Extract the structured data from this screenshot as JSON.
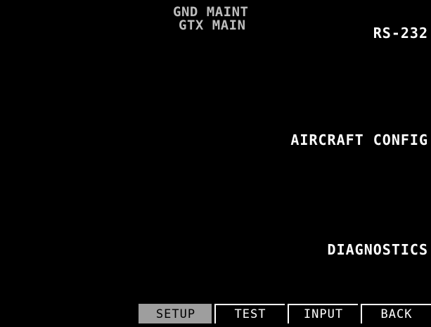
{
  "header": {
    "line1": "GND MAINT",
    "line2": "GTX MAIN"
  },
  "softkeys": {
    "rs232": "RS-232",
    "aircraft_config": "AIRCRAFT CONFIG",
    "diagnostics": "DIAGNOSTICS"
  },
  "tabs": [
    {
      "label": "SETUP",
      "active": true
    },
    {
      "label": "TEST",
      "active": false
    },
    {
      "label": "INPUT",
      "active": false
    },
    {
      "label": "BACK",
      "active": false
    }
  ],
  "colors": {
    "background": "#000000",
    "text": "#ffffff",
    "title_text": "#bdbdbd",
    "active_tab_bg": "#9e9e9e"
  }
}
